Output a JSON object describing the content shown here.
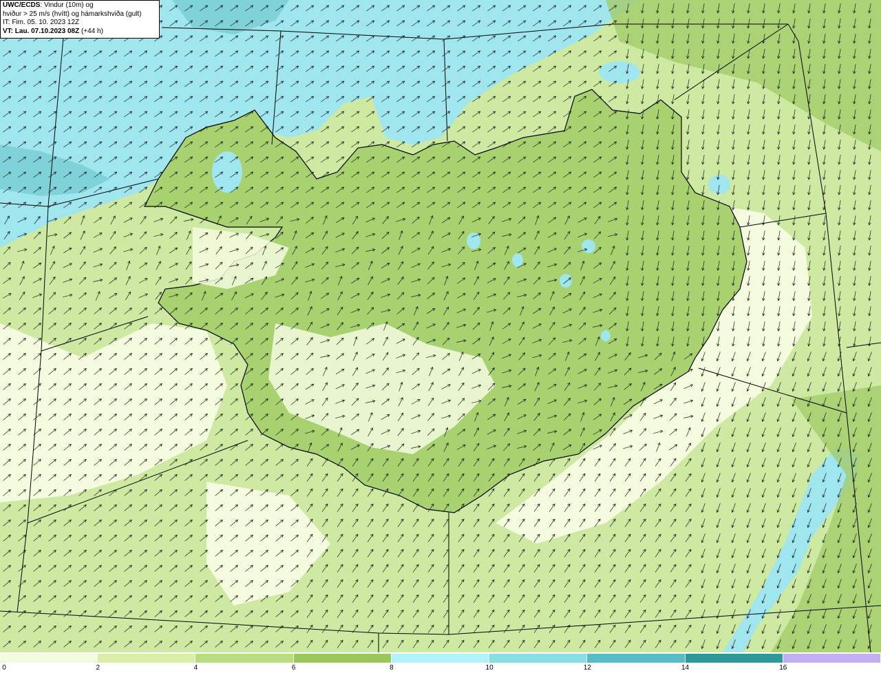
{
  "header": {
    "title_bold": "UWC/ECDS",
    "title_rest": ": Vindur (10m) og",
    "line2": "hviður > 25 m/s (hvítt) og hámarkshviða (gult)",
    "line3": "IT: Fim. 05. 10. 2023 12Z",
    "line4_bold": "VT: Lau. 07.10.2023 08Z",
    "line4_rest": " (+44 h)"
  },
  "legend": {
    "ticks": [
      "0",
      "2",
      "4",
      "6",
      "8",
      "10",
      "12",
      "14",
      "16"
    ],
    "colors": [
      "#f5fbdf",
      "#d9efa7",
      "#b8dc7e",
      "#99c95b",
      "#aef4f9",
      "#88dfe3",
      "#57bcc3",
      "#2e9a98",
      "#c2aff2"
    ]
  },
  "map": {
    "sea_color": "#cde9a2",
    "land_color": "#a8d270",
    "calm_color": "#f5fbdf",
    "strong_color": "#9fe6ee",
    "arrow_color": "#1a1a1a"
  }
}
